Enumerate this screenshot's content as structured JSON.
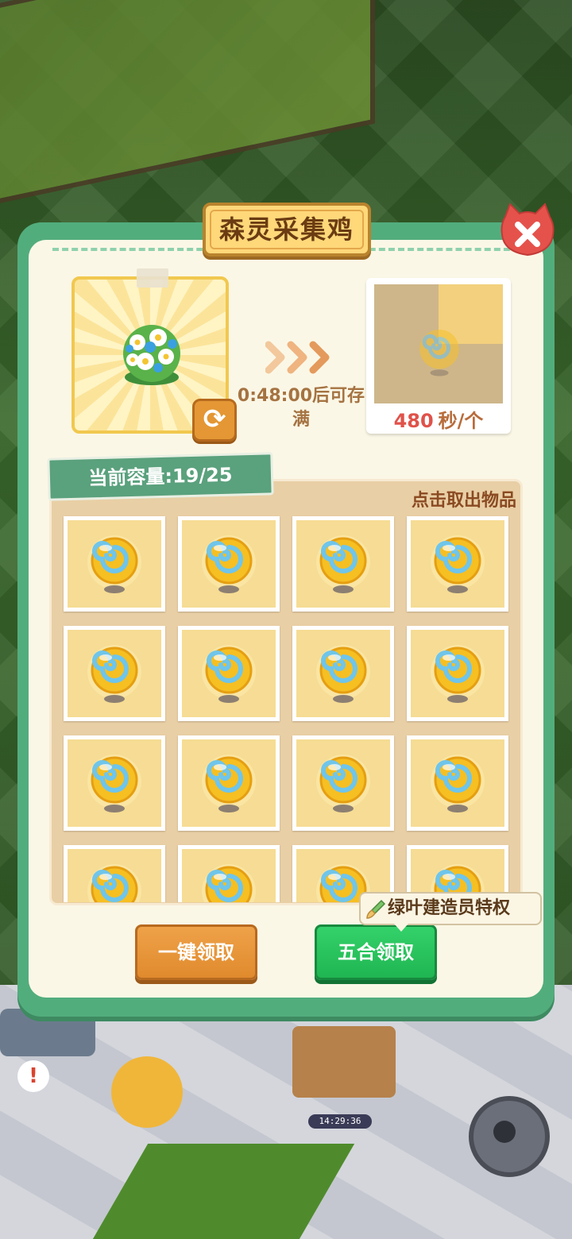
{
  "dialog": {
    "title": "森灵采集鸡",
    "close_icon": "close-icon",
    "refresh_icon": "refresh-icon",
    "fill_time_text": "0:48:00后可存满",
    "rate_value": "480",
    "rate_unit": "秒/个",
    "capacity_text": "当前容量:19/25",
    "hint_text": "点击取出物品",
    "item_icon": "golden-orb-icon",
    "items_visible": 16,
    "buttons": {
      "collect_all": "一键领取",
      "five_merge": "五合领取"
    },
    "privilege_badge": "绿叶建造员特权"
  },
  "background": {
    "clock_text": "14:29:36"
  },
  "colors": {
    "dialog_border": "#52ad7d",
    "panel_bg": "#fbf7e6",
    "accent_orange": "#e08a2d",
    "accent_green": "#1fb652",
    "rate_number": "#e0524a"
  }
}
